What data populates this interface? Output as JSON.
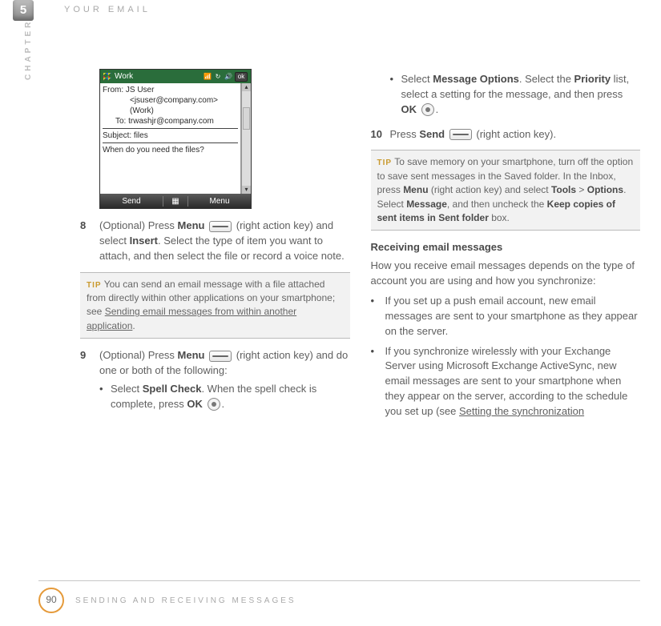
{
  "header": {
    "chapter_num": "5",
    "chapter_label": "CHAPTER",
    "section_title": "YOUR EMAIL"
  },
  "footer": {
    "page_num": "90",
    "section_title": "SENDING AND RECEIVING MESSAGES"
  },
  "screenshot": {
    "title": "Work",
    "ok_label": "ok",
    "from_label": "From:",
    "from_name": "JS User",
    "from_email": "<jsuser@company.com>",
    "from_account": "(Work)",
    "to_label": "To:",
    "to_value": "trwashjr@company.com",
    "subject_label": "Subject:",
    "subject_value": "files",
    "body_text": "When do you need the files?",
    "soft_left": "Send",
    "soft_right": "Menu",
    "kbd_glyph": "▦"
  },
  "left": {
    "step8_num": "8",
    "step8_a": "(Optional)  Press ",
    "step8_menu": "Menu",
    "step8_b": " (right action key) and select ",
    "step8_insert": "Insert",
    "step8_c": ". Select the type of item you want to attach, and then select the file or record a voice note.",
    "tip1_label": "TIP",
    "tip1_a": "You can send an email message with a file attached from directly within other applications on your smartphone; see ",
    "tip1_link": "Sending email messages from within another application",
    "tip1_c": ".",
    "step9_num": "9",
    "step9_a": "(Optional)  Press ",
    "step9_menu": "Menu",
    "step9_b": " (right action key) and do one or both of the following:",
    "sub9a_a": "Select ",
    "sub9a_spell": "Spell Check",
    "sub9a_b": ". When the spell check is complete, press ",
    "sub9a_ok": "OK",
    "sub9a_c": "."
  },
  "right": {
    "sub9b_a": "Select ",
    "sub9b_msgopt": "Message Options",
    "sub9b_b": ". Select the ",
    "sub9b_priority": "Priority",
    "sub9b_c": " list, select a setting for the message, and then press ",
    "sub9b_ok": "OK",
    "sub9b_d": ".",
    "step10_num": "10",
    "step10_a": "Press ",
    "step10_send": "Send",
    "step10_b": " (right action key).",
    "tip2_label": "TIP",
    "tip2_a": "To save memory on your smartphone, turn off the option to save sent messages in the Saved folder. In the Inbox, press ",
    "tip2_menu": "Menu",
    "tip2_b": " (right action key) and select ",
    "tip2_tools": "Tools",
    "tip2_gt": " > ",
    "tip2_options": "Options",
    "tip2_c": ". Select ",
    "tip2_message": "Message",
    "tip2_d": ", and then uncheck the ",
    "tip2_keep": "Keep copies of sent items in Sent folder",
    "tip2_e": " box.",
    "heading_receiving": "Receiving email messages",
    "recv_intro": "How you receive email messages depends on the type of account you are using and how you synchronize:",
    "b1": "If you set up a push email account, new email messages are sent to your smartphone as they appear on the server.",
    "b2_a": "If you synchronize wirelessly with your Exchange Server using Microsoft Exchange ActiveSync, new email messages are sent to your smartphone when they appear on the server, according to the schedule you set up (see ",
    "b2_link": "Setting the synchronization "
  }
}
